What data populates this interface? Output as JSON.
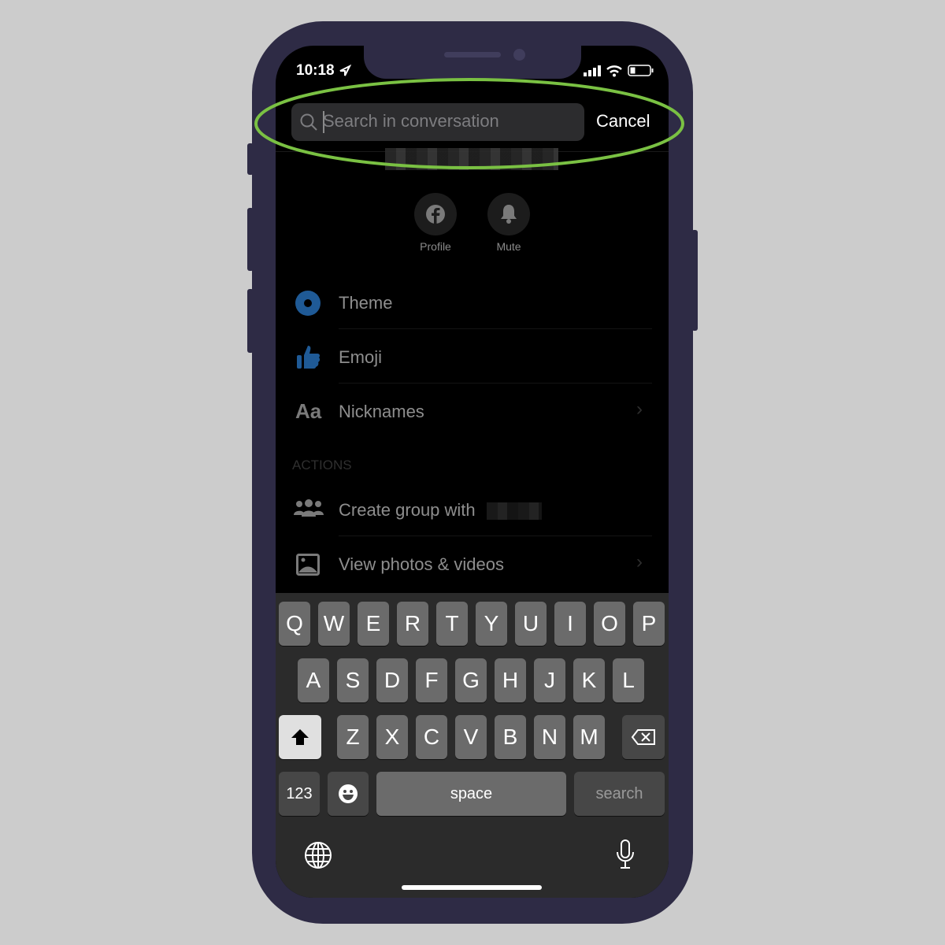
{
  "status_bar": {
    "time": "10:18",
    "location_icon": "location-arrow-icon",
    "signal_icon": "cellular-signal-icon",
    "wifi_icon": "wifi-icon",
    "battery_icon": "battery-icon"
  },
  "search": {
    "placeholder": "Search in conversation",
    "cancel_label": "Cancel",
    "highlight_color": "#7ac143"
  },
  "quick_actions": [
    {
      "label": "Profile",
      "icon": "facebook-icon"
    },
    {
      "label": "Mute",
      "icon": "bell-icon"
    }
  ],
  "settings": [
    {
      "label": "Theme",
      "icon": "theme-circle-icon"
    },
    {
      "label": "Emoji",
      "icon": "thumbs-up-icon"
    },
    {
      "label": "Nicknames",
      "icon": "text-aa-icon"
    }
  ],
  "actions_header": "ACTIONS",
  "actions": [
    {
      "label": "Create group with",
      "icon": "group-icon"
    },
    {
      "label": "View photos & videos",
      "icon": "photo-icon"
    }
  ],
  "accent_color": "#1f5a96",
  "keyboard": {
    "row1": [
      "Q",
      "W",
      "E",
      "R",
      "T",
      "Y",
      "U",
      "I",
      "O",
      "P"
    ],
    "row2": [
      "A",
      "S",
      "D",
      "F",
      "G",
      "H",
      "J",
      "K",
      "L"
    ],
    "row3": [
      "Z",
      "X",
      "C",
      "V",
      "B",
      "N",
      "M"
    ],
    "numbers_label": "123",
    "space_label": "space",
    "search_label": "search"
  }
}
